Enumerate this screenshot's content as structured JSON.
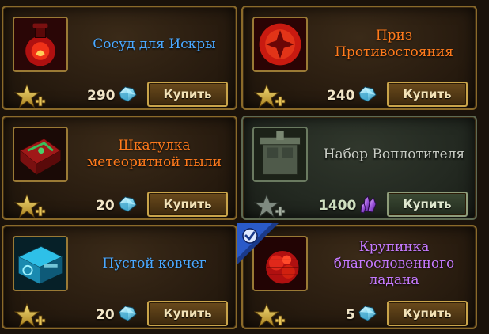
{
  "colors": {
    "name_blue": "#4aa8ff",
    "name_orange": "#ff7a1c",
    "name_gray": "#c8ccc4",
    "name_purple": "#c67aff",
    "gold_border": "#8a6a2a"
  },
  "items": [
    {
      "name": "Сосуд для Искры",
      "price": "290",
      "currency_icon": "crystal-icon",
      "buy_label": "Купить",
      "icon": "spark-vessel-icon"
    },
    {
      "name": "Приз\nПротивостояния",
      "price": "240",
      "currency_icon": "crystal-icon",
      "buy_label": "Купить",
      "icon": "prize-icon"
    },
    {
      "name": "Шкатулка\nметеоритной пыли",
      "price": "20",
      "currency_icon": "crystal-icon",
      "buy_label": "Купить",
      "icon": "meteor-dust-box-icon"
    },
    {
      "name": "Набор Воплотителя",
      "price": "1400",
      "currency_icon": "purple-crystal-icon",
      "buy_label": "Купить",
      "icon": "embodier-set-icon"
    },
    {
      "name": "Пустой ковчег",
      "price": "20",
      "currency_icon": "crystal-icon",
      "buy_label": "Купить",
      "icon": "empty-ark-icon"
    },
    {
      "name": "Крупинка\nблагословенного\nладана",
      "price": "5",
      "currency_icon": "crystal-icon",
      "buy_label": "Купить",
      "icon": "incense-grain-icon"
    }
  ]
}
